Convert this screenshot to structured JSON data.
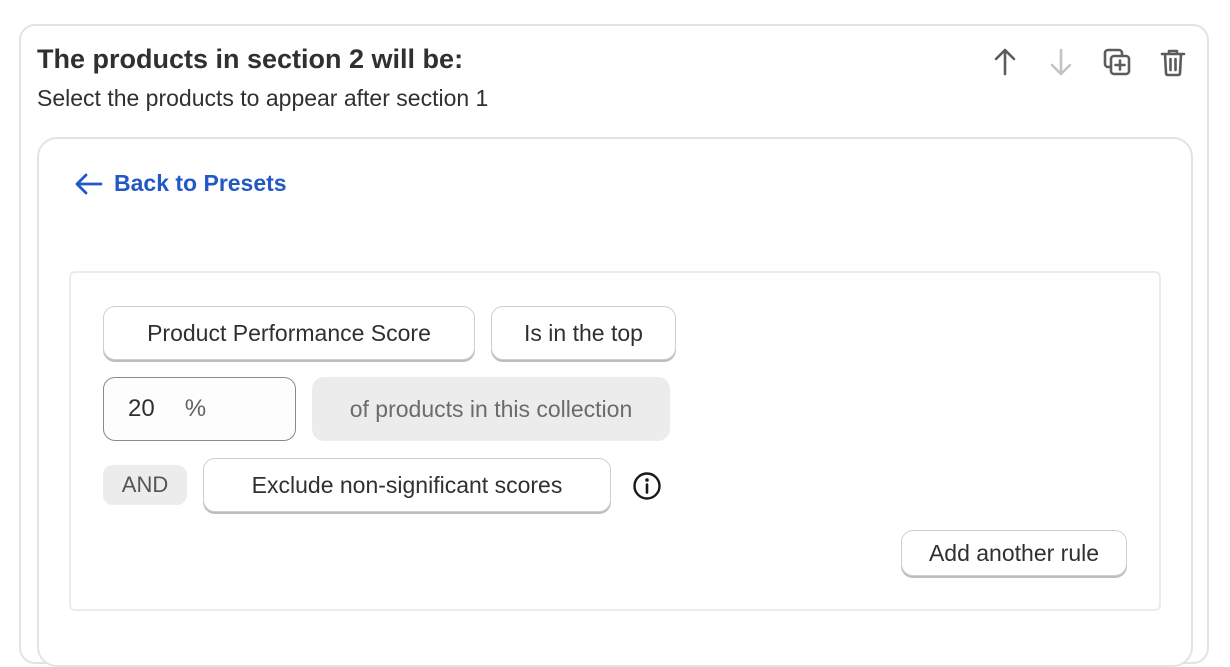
{
  "section": {
    "title": "The products in section 2 will be:",
    "subtitle": "Select the products to appear after section 1"
  },
  "toolbar": {
    "icons": [
      "arrow-up-icon",
      "arrow-down-icon",
      "duplicate-icon",
      "trash-icon"
    ]
  },
  "back_link": {
    "label": "Back to Presets"
  },
  "rule": {
    "field_label": "Product Performance Score",
    "operator_label": "Is in the top",
    "value": "20",
    "value_suffix": "%",
    "scope_text": "of products in this collection",
    "connector": "AND",
    "exclude_label": "Exclude non-significant scores"
  },
  "add_rule_label": "Add another rule",
  "colors": {
    "link": "#2358c7",
    "text": "#303030",
    "disabled_icon": "#c4c4c4"
  }
}
